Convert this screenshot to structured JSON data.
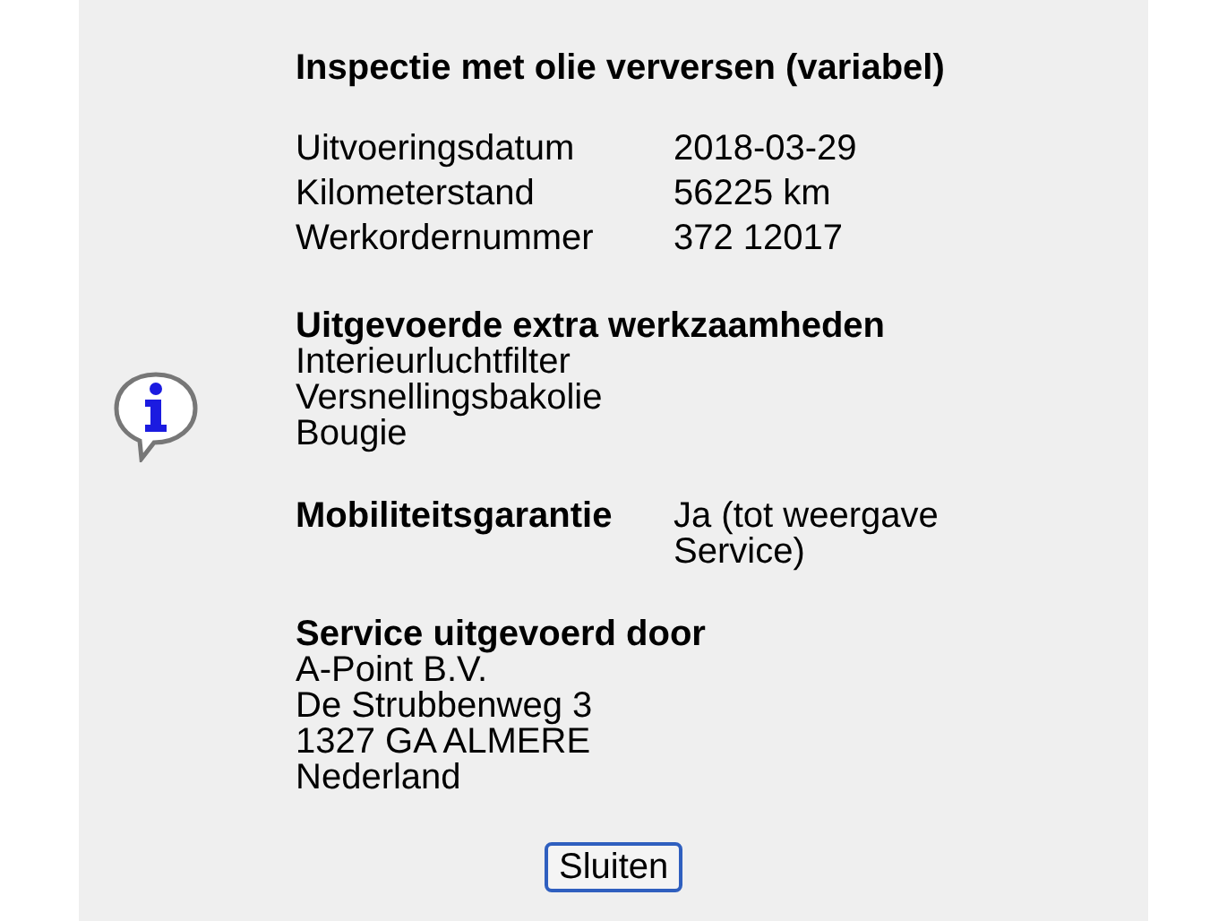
{
  "title": "Inspectie met olie verversen (variabel)",
  "details": [
    {
      "label": "Uitvoeringsdatum",
      "value": "2018-03-29"
    },
    {
      "label": "Kilometerstand",
      "value": "56225 km"
    },
    {
      "label": "Werkordernummer",
      "value": "372 12017"
    }
  ],
  "extra_work": {
    "heading": "Uitgevoerde extra werkzaamheden",
    "items": [
      "Interieurluchtfilter",
      "Versnellingsbakolie",
      "Bougie"
    ]
  },
  "mobility": {
    "label": "Mobiliteitsgarantie",
    "value": "Ja (tot weergave Service)"
  },
  "service_by": {
    "heading": "Service uitgevoerd door",
    "lines": [
      "A-Point B.V.",
      "De Strubbenweg 3",
      "1327 GA ALMERE",
      "Nederland"
    ]
  },
  "button": "Sluiten"
}
